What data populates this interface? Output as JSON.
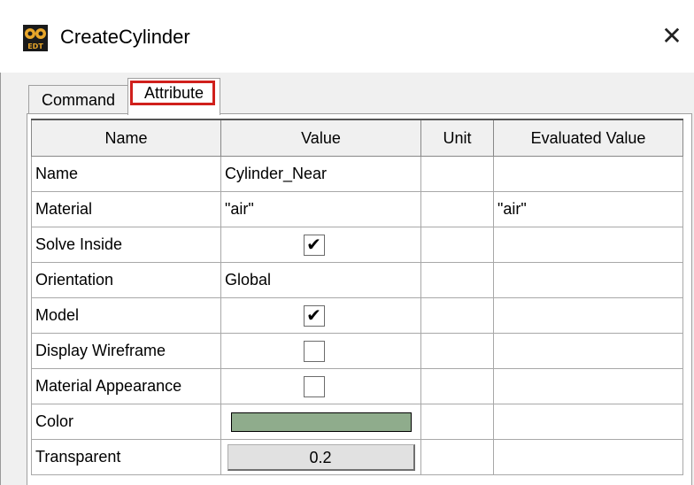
{
  "window": {
    "title": "CreateCylinder",
    "close_glyph": "✕",
    "icon": "aedt-app-icon"
  },
  "tabs": [
    {
      "label": "Command",
      "selected": false
    },
    {
      "label": "Attribute",
      "selected": true,
      "highlight_color": "#d0201c"
    }
  ],
  "grid": {
    "columns": [
      "Name",
      "Value",
      "Unit",
      "Evaluated Value"
    ],
    "rows": [
      {
        "name": "Name",
        "value": "Cylinder_Near",
        "unit": "",
        "evaluated": ""
      },
      {
        "name": "Material",
        "value": "\"air\"",
        "unit": "",
        "evaluated": "\"air\""
      },
      {
        "name": "Solve Inside",
        "value_checkbox": true,
        "unit": "",
        "evaluated": ""
      },
      {
        "name": "Orientation",
        "value": "Global",
        "unit": "",
        "evaluated": ""
      },
      {
        "name": "Model",
        "value_checkbox": true,
        "unit": "",
        "evaluated": ""
      },
      {
        "name": "Display Wireframe",
        "value_checkbox": false,
        "unit": "",
        "evaluated": ""
      },
      {
        "name": "Material Appearance",
        "value_checkbox": false,
        "unit": "",
        "evaluated": ""
      },
      {
        "name": "Color",
        "value_color": "#8fac8c",
        "unit": "",
        "evaluated": ""
      },
      {
        "name": "Transparent",
        "value_button": "0.2",
        "unit": "",
        "evaluated": ""
      }
    ]
  },
  "checkmark_glyph": "✔"
}
